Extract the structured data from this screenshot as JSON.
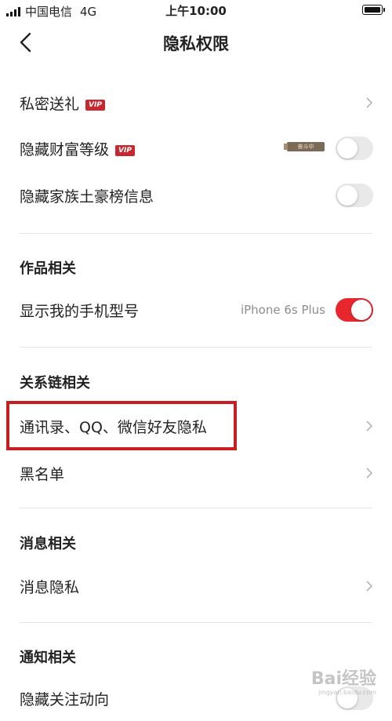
{
  "status_bar": {
    "carrier": "中国电信",
    "network": "4G",
    "time": "上午10:00"
  },
  "nav": {
    "title": "隐私权限"
  },
  "rows": {
    "private_gift": {
      "label": "私密送礼",
      "badge": "VIP"
    },
    "hide_wealth": {
      "label": "隐藏财富等级",
      "badge": "VIP",
      "level_badge": "奋斗中",
      "toggle_on": false
    },
    "hide_family": {
      "label": "隐藏家族土豪榜信息",
      "toggle_on": false
    },
    "show_phone_model": {
      "label": "显示我的手机型号",
      "value": "iPhone 6s Plus",
      "toggle_on": true
    },
    "contacts_privacy": {
      "label": "通讯录、QQ、微信好友隐私"
    },
    "blacklist": {
      "label": "黑名单"
    },
    "message_privacy": {
      "label": "消息隐私"
    },
    "hide_follow": {
      "label": "隐藏关注动向"
    }
  },
  "sections": {
    "works": "作品相关",
    "relations": "关系链相关",
    "messages": "消息相关",
    "notifications": "通知相关"
  },
  "watermark": {
    "text": "Bai经验",
    "sub": "jingyan.baidu.com"
  },
  "colors": {
    "accent": "#e8262e",
    "highlight_box": "#c81e22",
    "vip_badge": "#c5282e"
  }
}
